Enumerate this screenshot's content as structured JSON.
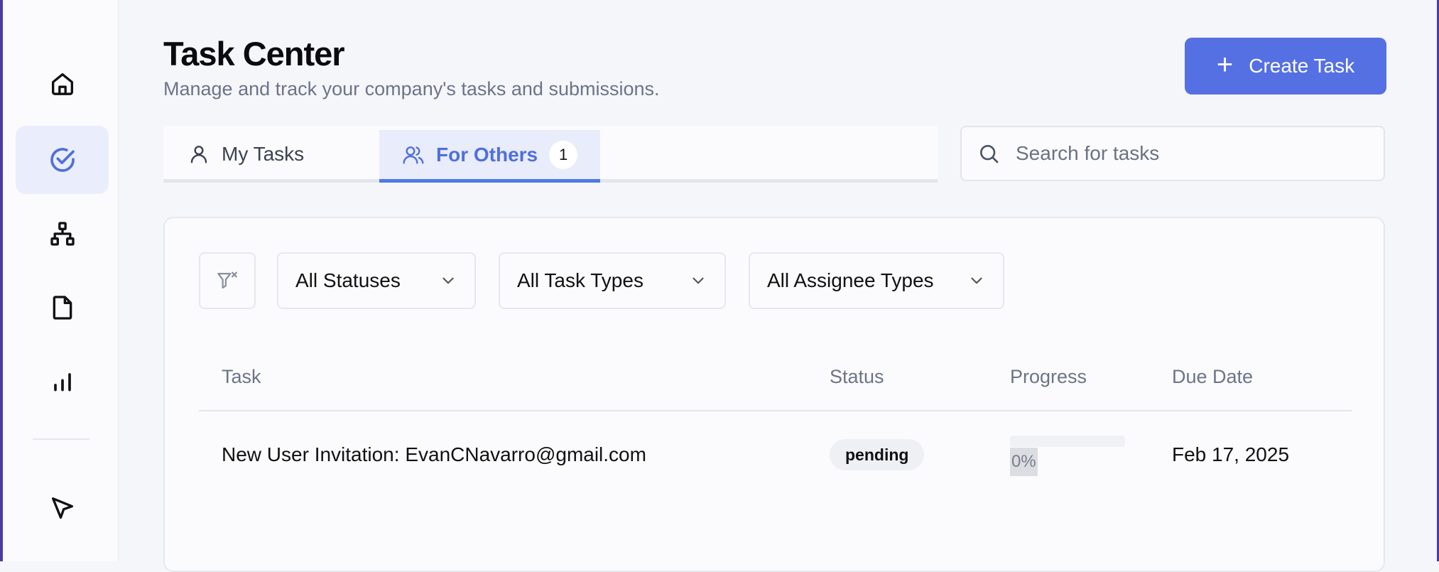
{
  "sidebar": {
    "items": [
      {
        "icon": "home-icon"
      },
      {
        "icon": "check-circle-icon",
        "active": true
      },
      {
        "icon": "org-chart-icon"
      },
      {
        "icon": "document-icon"
      },
      {
        "icon": "bar-chart-icon"
      },
      {
        "icon": "cursor-arrow-icon"
      }
    ]
  },
  "header": {
    "title": "Task Center",
    "subtitle": "Manage and track your company's tasks and submissions.",
    "create_button": "Create Task"
  },
  "tabs": {
    "my_tasks": "My Tasks",
    "for_others": "For Others",
    "for_others_count": "1"
  },
  "search": {
    "placeholder": "Search for tasks",
    "value": ""
  },
  "filters": {
    "status": "All Statuses",
    "task_types": "All Task Types",
    "assignee_types": "All Assignee Types"
  },
  "table": {
    "columns": [
      "Task",
      "Status",
      "Progress",
      "Due Date"
    ],
    "rows": [
      {
        "task": "New User Invitation: EvanCNavarro@gmail.com",
        "status": "pending",
        "progress": 0,
        "progress_label": "0%",
        "due_date": "Feb 17, 2025"
      }
    ]
  },
  "colors": {
    "accent": "#5570e3",
    "active_tab_text": "#4f6fdc",
    "active_bg": "#eaedfb"
  }
}
